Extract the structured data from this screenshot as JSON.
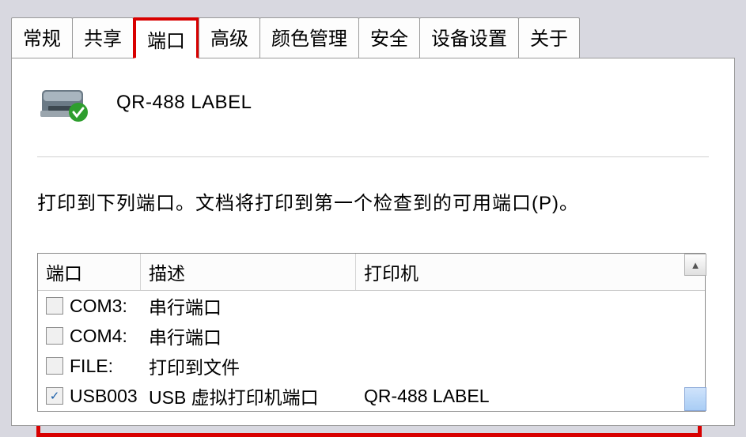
{
  "tabs": {
    "t0": "常规",
    "t1": "共享",
    "t2": "端口",
    "t3": "高级",
    "t4": "颜色管理",
    "t5": "安全",
    "t6": "设备设置",
    "t7": "关于"
  },
  "printer": {
    "name": "QR-488 LABEL"
  },
  "instruction": "打印到下列端口。文档将打印到第一个检查到的可用端口(P)。",
  "ports_table": {
    "headers": {
      "port": "端口",
      "desc": "描述",
      "printer": "打印机"
    },
    "rows": [
      {
        "checked": false,
        "port": "COM3:",
        "desc": "串行端口",
        "printer": ""
      },
      {
        "checked": false,
        "port": "COM4:",
        "desc": "串行端口",
        "printer": ""
      },
      {
        "checked": false,
        "port": "FILE:",
        "desc": "打印到文件",
        "printer": ""
      },
      {
        "checked": true,
        "port": "USB003",
        "desc": "USB 虚拟打印机端口",
        "printer": "QR-488 LABEL"
      }
    ]
  }
}
